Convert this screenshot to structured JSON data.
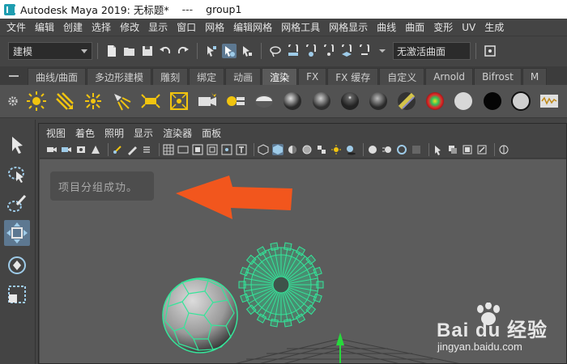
{
  "window": {
    "title": "Autodesk Maya 2019: 无标题*",
    "separator": "---",
    "selection": "group1"
  },
  "menubar": {
    "items": [
      "文件",
      "编辑",
      "创建",
      "选择",
      "修改",
      "显示",
      "窗口",
      "网格",
      "编辑网格",
      "网格工具",
      "网格显示",
      "曲线",
      "曲面",
      "变形",
      "UV",
      "生成"
    ]
  },
  "statusline": {
    "mode": "建模",
    "inactive_field": "无激活曲面"
  },
  "shelf": {
    "tabs": [
      "曲线/曲面",
      "多边形建模",
      "雕刻",
      "绑定",
      "动画",
      "渲染",
      "FX",
      "FX 缓存",
      "自定义",
      "Arnold",
      "Bifrost",
      "M"
    ],
    "active_tab": "渲染",
    "icons": [
      "sun-light-icon",
      "directional-light-icon",
      "point-light-icon",
      "spot-light-icon",
      "area-light-icon",
      "volume-light-icon",
      "camera-icon",
      "camera-aim-icon",
      "lambert-shader-icon",
      "blinn-shader-icon",
      "phong-shader-icon",
      "phong-e-shader-icon",
      "anisotropic-shader-icon",
      "ramp-shader-icon",
      "ocean-shader-icon",
      "surface-shader-icon",
      "layered-shader-icon",
      "use-background-icon",
      "render-view-icon"
    ]
  },
  "panel": {
    "menu": [
      "视图",
      "着色",
      "照明",
      "显示",
      "渲染器",
      "面板"
    ]
  },
  "viewport": {
    "message": "项目分组成功。",
    "arrow_color": "#f2561d",
    "wireframe_color": "#35e59a"
  },
  "watermark": {
    "brand": "Bai du 经验",
    "url": "jingyan.baidu.com"
  },
  "colors": {
    "ui_bg": "#444444",
    "viewport_bg": "#5c5c5c",
    "active_blue": "#5d7891"
  }
}
